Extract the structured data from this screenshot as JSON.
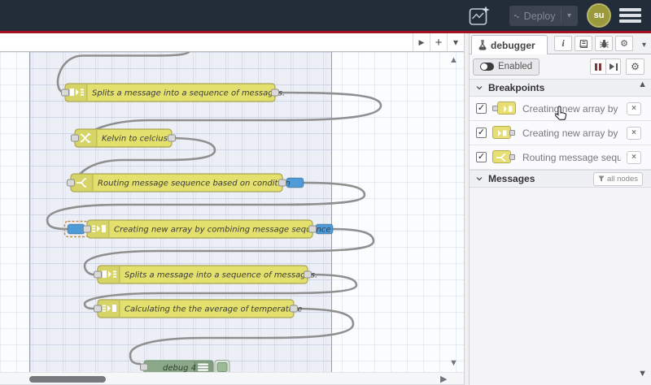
{
  "header": {
    "deploy": {
      "label": "Deploy"
    },
    "avatar": {
      "initials": "su"
    }
  },
  "glyphs": {
    "check": "✓",
    "close": "×",
    "caret_down": "▾",
    "gear": "⚙",
    "info": "i",
    "up": "▲",
    "down": "▼",
    "right": "▶",
    "plus": "+",
    "expand": "▶"
  },
  "canvas": {
    "nodes": [
      {
        "id": "split-1",
        "type": "split",
        "label": "Splits a message into a sequence of messages."
      },
      {
        "id": "change-1",
        "type": "change",
        "label": "Kelvin to celcius"
      },
      {
        "id": "switch-1",
        "type": "switch",
        "label": "Routing message sequence based on condition"
      },
      {
        "id": "join-1",
        "type": "join",
        "label": "Creating new array by combining message sequence"
      },
      {
        "id": "split-2",
        "type": "split",
        "label": "Splits a message into a sequence of messages."
      },
      {
        "id": "join-2",
        "type": "join",
        "label": "Calculating the the average of temperature"
      },
      {
        "id": "debug-4",
        "type": "debug",
        "label": "debug 4"
      }
    ],
    "colors": {
      "node_yellow": "#e3e06e",
      "node_yellow_border": "#a9a553",
      "node_green": "#8ba888",
      "node_green_border": "#71946e",
      "wire": "#8f8f8f",
      "breakpoint_blue": "#4f9bd7"
    }
  },
  "sidebar": {
    "active_tab": {
      "label": "debugger"
    },
    "toolbar": {
      "enabled_label": "Enabled"
    },
    "breakpoints": {
      "title": "Breakpoints",
      "items": [
        {
          "label": "Creating new array by combining message sequence",
          "checked": true,
          "port": "input"
        },
        {
          "label": "Creating new array by combining message sequence",
          "checked": true,
          "port": "output"
        },
        {
          "label": "Routing message sequence based on condition",
          "checked": true,
          "port": "output"
        }
      ]
    },
    "messages": {
      "title": "Messages",
      "filter_label": "all nodes"
    }
  }
}
